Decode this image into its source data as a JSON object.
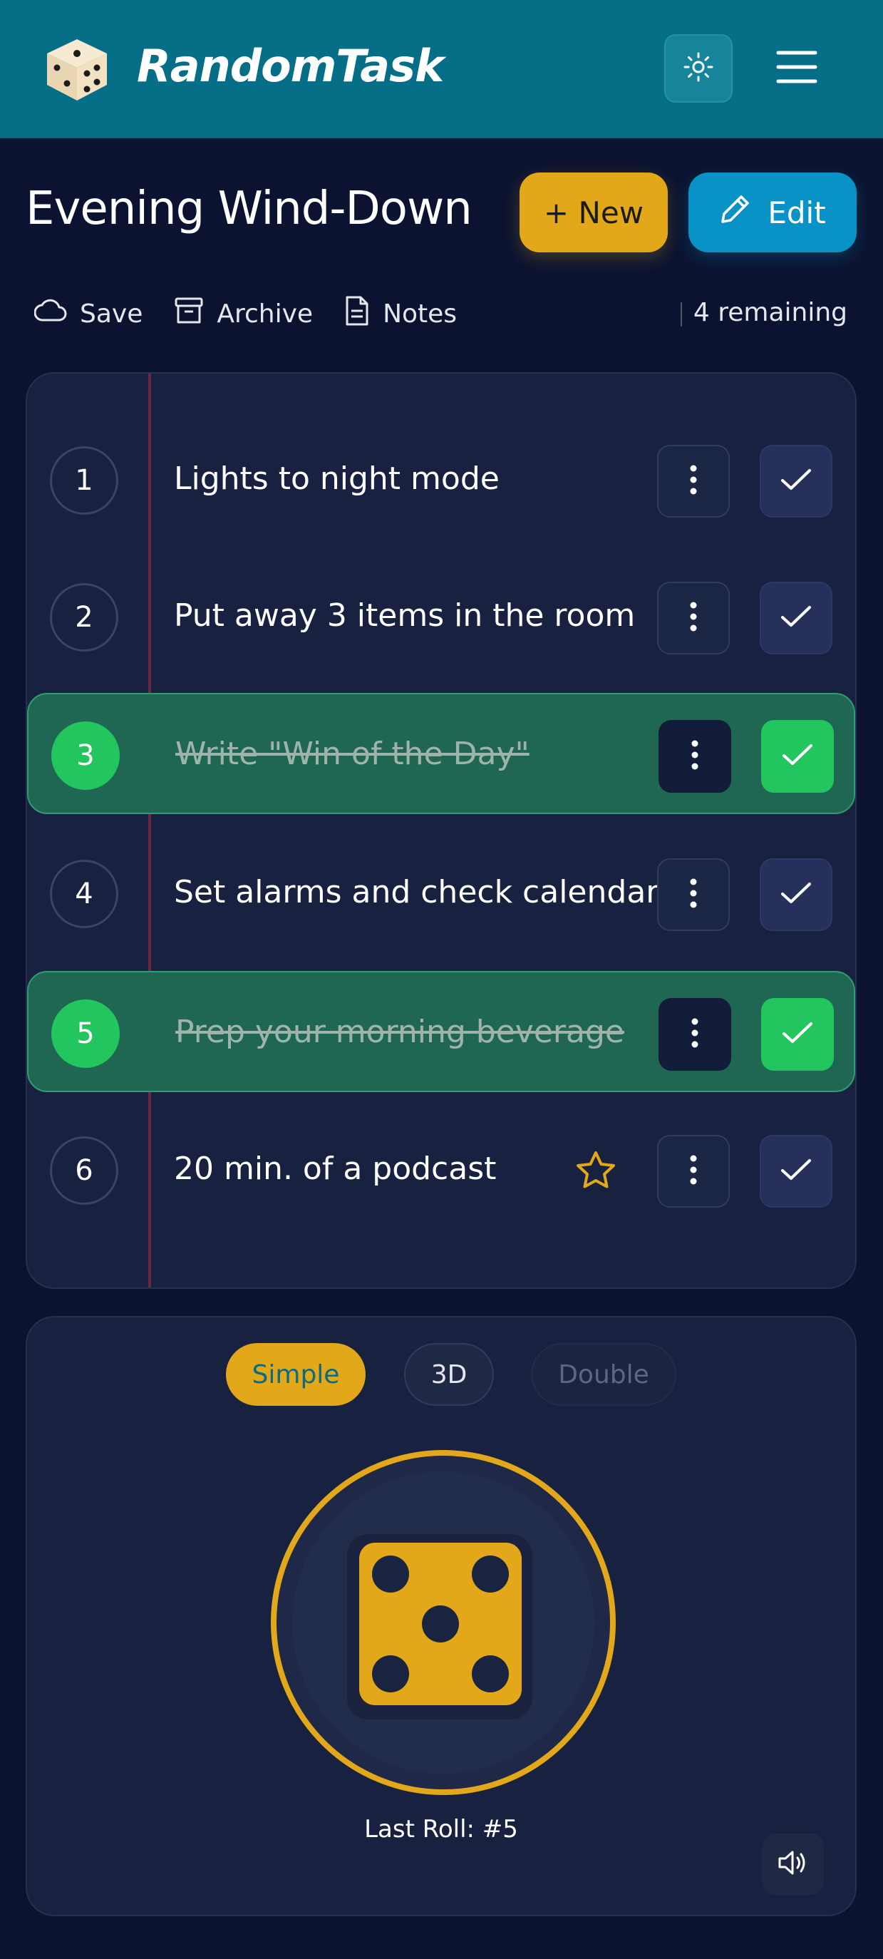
{
  "header": {
    "brand": "RandomTask",
    "logo_icon": "dice-icon",
    "theme_icon": "sun-icon",
    "menu_icon": "hamburger-menu-icon"
  },
  "page": {
    "title": "Evening Wind-Down",
    "new_label": "+ New",
    "edit_label": "Edit",
    "edit_icon": "pencil-icon"
  },
  "actions": {
    "save": "Save",
    "archive": "Archive",
    "notes": "Notes",
    "remaining": "4 remaining"
  },
  "tasks": [
    {
      "number": "1",
      "text": "Lights to night mode",
      "done": false,
      "starred": false
    },
    {
      "number": "2",
      "text": "Put away 3 items in the room",
      "done": false,
      "starred": false
    },
    {
      "number": "3",
      "text": "Write \"Win of the Day\"",
      "done": true,
      "starred": false
    },
    {
      "number": "4",
      "text": "Set alarms and check calendar",
      "done": false,
      "starred": false
    },
    {
      "number": "5",
      "text": "Prep your morning beverage",
      "done": true,
      "starred": false
    },
    {
      "number": "6",
      "text": "20 min. of a podcast",
      "done": false,
      "starred": true
    }
  ],
  "dice": {
    "modes": [
      "Simple",
      "3D",
      "Double"
    ],
    "selected_mode": "Simple",
    "face_value": 5,
    "last_roll": "Last Roll: #5",
    "sound_icon": "speaker-icon"
  },
  "colors": {
    "header_bg": "#066f87",
    "page_bg": "#0b1330",
    "accent_yellow": "#e2a81a",
    "accent_blue": "#0892c5",
    "done_green": "#22c55e"
  }
}
